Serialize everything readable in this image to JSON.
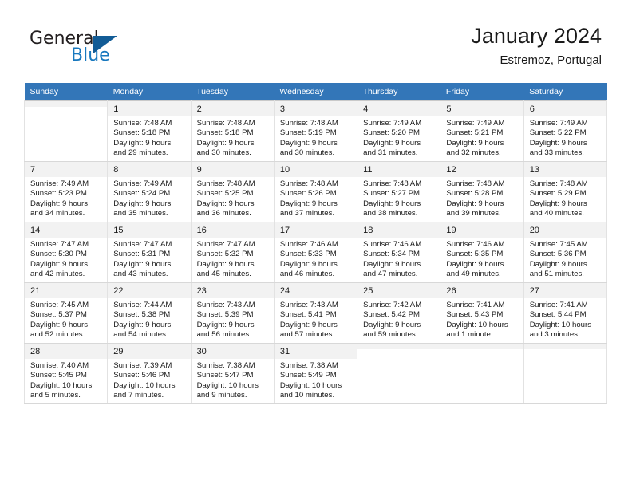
{
  "logo": {
    "word1": "General",
    "word2": "Blue",
    "triangle_color": "#125c96",
    "blue_color": "#1878be"
  },
  "header": {
    "title": "January 2024",
    "subtitle": "Estremoz, Portugal"
  },
  "theme": {
    "header_row_bg": "#3376b8",
    "header_row_text": "#ffffff",
    "daynum_bg": "#f2f2f2",
    "grid_line": "#d8d8d8"
  },
  "calendar": {
    "weekday_headers": [
      "Sunday",
      "Monday",
      "Tuesday",
      "Wednesday",
      "Thursday",
      "Friday",
      "Saturday"
    ],
    "labels": {
      "sunrise": "Sunrise:",
      "sunset": "Sunset:",
      "daylight": "Daylight:"
    },
    "weeks": [
      [
        {
          "day": "",
          "empty": true
        },
        {
          "day": "1",
          "sunrise": "Sunrise: 7:48 AM",
          "sunset": "Sunset: 5:18 PM",
          "daylight_l1": "Daylight: 9 hours",
          "daylight_l2": "and 29 minutes."
        },
        {
          "day": "2",
          "sunrise": "Sunrise: 7:48 AM",
          "sunset": "Sunset: 5:18 PM",
          "daylight_l1": "Daylight: 9 hours",
          "daylight_l2": "and 30 minutes."
        },
        {
          "day": "3",
          "sunrise": "Sunrise: 7:48 AM",
          "sunset": "Sunset: 5:19 PM",
          "daylight_l1": "Daylight: 9 hours",
          "daylight_l2": "and 30 minutes."
        },
        {
          "day": "4",
          "sunrise": "Sunrise: 7:49 AM",
          "sunset": "Sunset: 5:20 PM",
          "daylight_l1": "Daylight: 9 hours",
          "daylight_l2": "and 31 minutes."
        },
        {
          "day": "5",
          "sunrise": "Sunrise: 7:49 AM",
          "sunset": "Sunset: 5:21 PM",
          "daylight_l1": "Daylight: 9 hours",
          "daylight_l2": "and 32 minutes."
        },
        {
          "day": "6",
          "sunrise": "Sunrise: 7:49 AM",
          "sunset": "Sunset: 5:22 PM",
          "daylight_l1": "Daylight: 9 hours",
          "daylight_l2": "and 33 minutes."
        }
      ],
      [
        {
          "day": "7",
          "sunrise": "Sunrise: 7:49 AM",
          "sunset": "Sunset: 5:23 PM",
          "daylight_l1": "Daylight: 9 hours",
          "daylight_l2": "and 34 minutes."
        },
        {
          "day": "8",
          "sunrise": "Sunrise: 7:49 AM",
          "sunset": "Sunset: 5:24 PM",
          "daylight_l1": "Daylight: 9 hours",
          "daylight_l2": "and 35 minutes."
        },
        {
          "day": "9",
          "sunrise": "Sunrise: 7:48 AM",
          "sunset": "Sunset: 5:25 PM",
          "daylight_l1": "Daylight: 9 hours",
          "daylight_l2": "and 36 minutes."
        },
        {
          "day": "10",
          "sunrise": "Sunrise: 7:48 AM",
          "sunset": "Sunset: 5:26 PM",
          "daylight_l1": "Daylight: 9 hours",
          "daylight_l2": "and 37 minutes."
        },
        {
          "day": "11",
          "sunrise": "Sunrise: 7:48 AM",
          "sunset": "Sunset: 5:27 PM",
          "daylight_l1": "Daylight: 9 hours",
          "daylight_l2": "and 38 minutes."
        },
        {
          "day": "12",
          "sunrise": "Sunrise: 7:48 AM",
          "sunset": "Sunset: 5:28 PM",
          "daylight_l1": "Daylight: 9 hours",
          "daylight_l2": "and 39 minutes."
        },
        {
          "day": "13",
          "sunrise": "Sunrise: 7:48 AM",
          "sunset": "Sunset: 5:29 PM",
          "daylight_l1": "Daylight: 9 hours",
          "daylight_l2": "and 40 minutes."
        }
      ],
      [
        {
          "day": "14",
          "sunrise": "Sunrise: 7:47 AM",
          "sunset": "Sunset: 5:30 PM",
          "daylight_l1": "Daylight: 9 hours",
          "daylight_l2": "and 42 minutes."
        },
        {
          "day": "15",
          "sunrise": "Sunrise: 7:47 AM",
          "sunset": "Sunset: 5:31 PM",
          "daylight_l1": "Daylight: 9 hours",
          "daylight_l2": "and 43 minutes."
        },
        {
          "day": "16",
          "sunrise": "Sunrise: 7:47 AM",
          "sunset": "Sunset: 5:32 PM",
          "daylight_l1": "Daylight: 9 hours",
          "daylight_l2": "and 45 minutes."
        },
        {
          "day": "17",
          "sunrise": "Sunrise: 7:46 AM",
          "sunset": "Sunset: 5:33 PM",
          "daylight_l1": "Daylight: 9 hours",
          "daylight_l2": "and 46 minutes."
        },
        {
          "day": "18",
          "sunrise": "Sunrise: 7:46 AM",
          "sunset": "Sunset: 5:34 PM",
          "daylight_l1": "Daylight: 9 hours",
          "daylight_l2": "and 47 minutes."
        },
        {
          "day": "19",
          "sunrise": "Sunrise: 7:46 AM",
          "sunset": "Sunset: 5:35 PM",
          "daylight_l1": "Daylight: 9 hours",
          "daylight_l2": "and 49 minutes."
        },
        {
          "day": "20",
          "sunrise": "Sunrise: 7:45 AM",
          "sunset": "Sunset: 5:36 PM",
          "daylight_l1": "Daylight: 9 hours",
          "daylight_l2": "and 51 minutes."
        }
      ],
      [
        {
          "day": "21",
          "sunrise": "Sunrise: 7:45 AM",
          "sunset": "Sunset: 5:37 PM",
          "daylight_l1": "Daylight: 9 hours",
          "daylight_l2": "and 52 minutes."
        },
        {
          "day": "22",
          "sunrise": "Sunrise: 7:44 AM",
          "sunset": "Sunset: 5:38 PM",
          "daylight_l1": "Daylight: 9 hours",
          "daylight_l2": "and 54 minutes."
        },
        {
          "day": "23",
          "sunrise": "Sunrise: 7:43 AM",
          "sunset": "Sunset: 5:39 PM",
          "daylight_l1": "Daylight: 9 hours",
          "daylight_l2": "and 56 minutes."
        },
        {
          "day": "24",
          "sunrise": "Sunrise: 7:43 AM",
          "sunset": "Sunset: 5:41 PM",
          "daylight_l1": "Daylight: 9 hours",
          "daylight_l2": "and 57 minutes."
        },
        {
          "day": "25",
          "sunrise": "Sunrise: 7:42 AM",
          "sunset": "Sunset: 5:42 PM",
          "daylight_l1": "Daylight: 9 hours",
          "daylight_l2": "and 59 minutes."
        },
        {
          "day": "26",
          "sunrise": "Sunrise: 7:41 AM",
          "sunset": "Sunset: 5:43 PM",
          "daylight_l1": "Daylight: 10 hours",
          "daylight_l2": "and 1 minute."
        },
        {
          "day": "27",
          "sunrise": "Sunrise: 7:41 AM",
          "sunset": "Sunset: 5:44 PM",
          "daylight_l1": "Daylight: 10 hours",
          "daylight_l2": "and 3 minutes."
        }
      ],
      [
        {
          "day": "28",
          "sunrise": "Sunrise: 7:40 AM",
          "sunset": "Sunset: 5:45 PM",
          "daylight_l1": "Daylight: 10 hours",
          "daylight_l2": "and 5 minutes."
        },
        {
          "day": "29",
          "sunrise": "Sunrise: 7:39 AM",
          "sunset": "Sunset: 5:46 PM",
          "daylight_l1": "Daylight: 10 hours",
          "daylight_l2": "and 7 minutes."
        },
        {
          "day": "30",
          "sunrise": "Sunrise: 7:38 AM",
          "sunset": "Sunset: 5:47 PM",
          "daylight_l1": "Daylight: 10 hours",
          "daylight_l2": "and 9 minutes."
        },
        {
          "day": "31",
          "sunrise": "Sunrise: 7:38 AM",
          "sunset": "Sunset: 5:49 PM",
          "daylight_l1": "Daylight: 10 hours",
          "daylight_l2": "and 10 minutes."
        },
        {
          "day": "",
          "empty": true
        },
        {
          "day": "",
          "empty": true
        },
        {
          "day": "",
          "empty": true
        }
      ]
    ]
  }
}
